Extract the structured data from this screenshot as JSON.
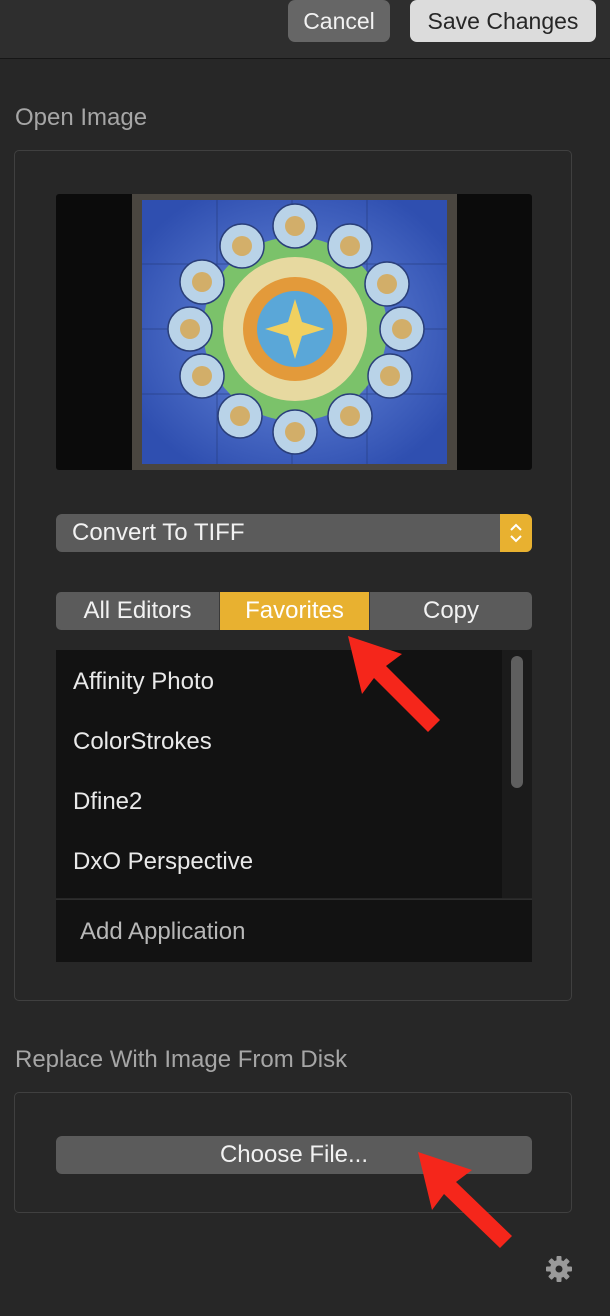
{
  "header": {
    "cancel_label": "Cancel",
    "save_label": "Save Changes"
  },
  "open_image": {
    "title": "Open Image",
    "format_select": {
      "selected": "Convert To TIFF"
    },
    "editor_tabs": [
      {
        "label": "All Editors",
        "active": false
      },
      {
        "label": "Favorites",
        "active": true
      },
      {
        "label": "Copy",
        "active": false
      }
    ],
    "editors": [
      "Affinity Photo",
      "ColorStrokes",
      "Dfine2",
      "DxO Perspective"
    ],
    "add_application_label": "Add Application"
  },
  "replace_image": {
    "title": "Replace With Image From Disk",
    "choose_file_label": "Choose File..."
  },
  "icons": {
    "settings": "gear-icon",
    "select_stepper": "chevron-updown-icon"
  },
  "colors": {
    "accent": "#e8b130",
    "annotation_arrow": "#f5261b",
    "background": "#272727"
  }
}
